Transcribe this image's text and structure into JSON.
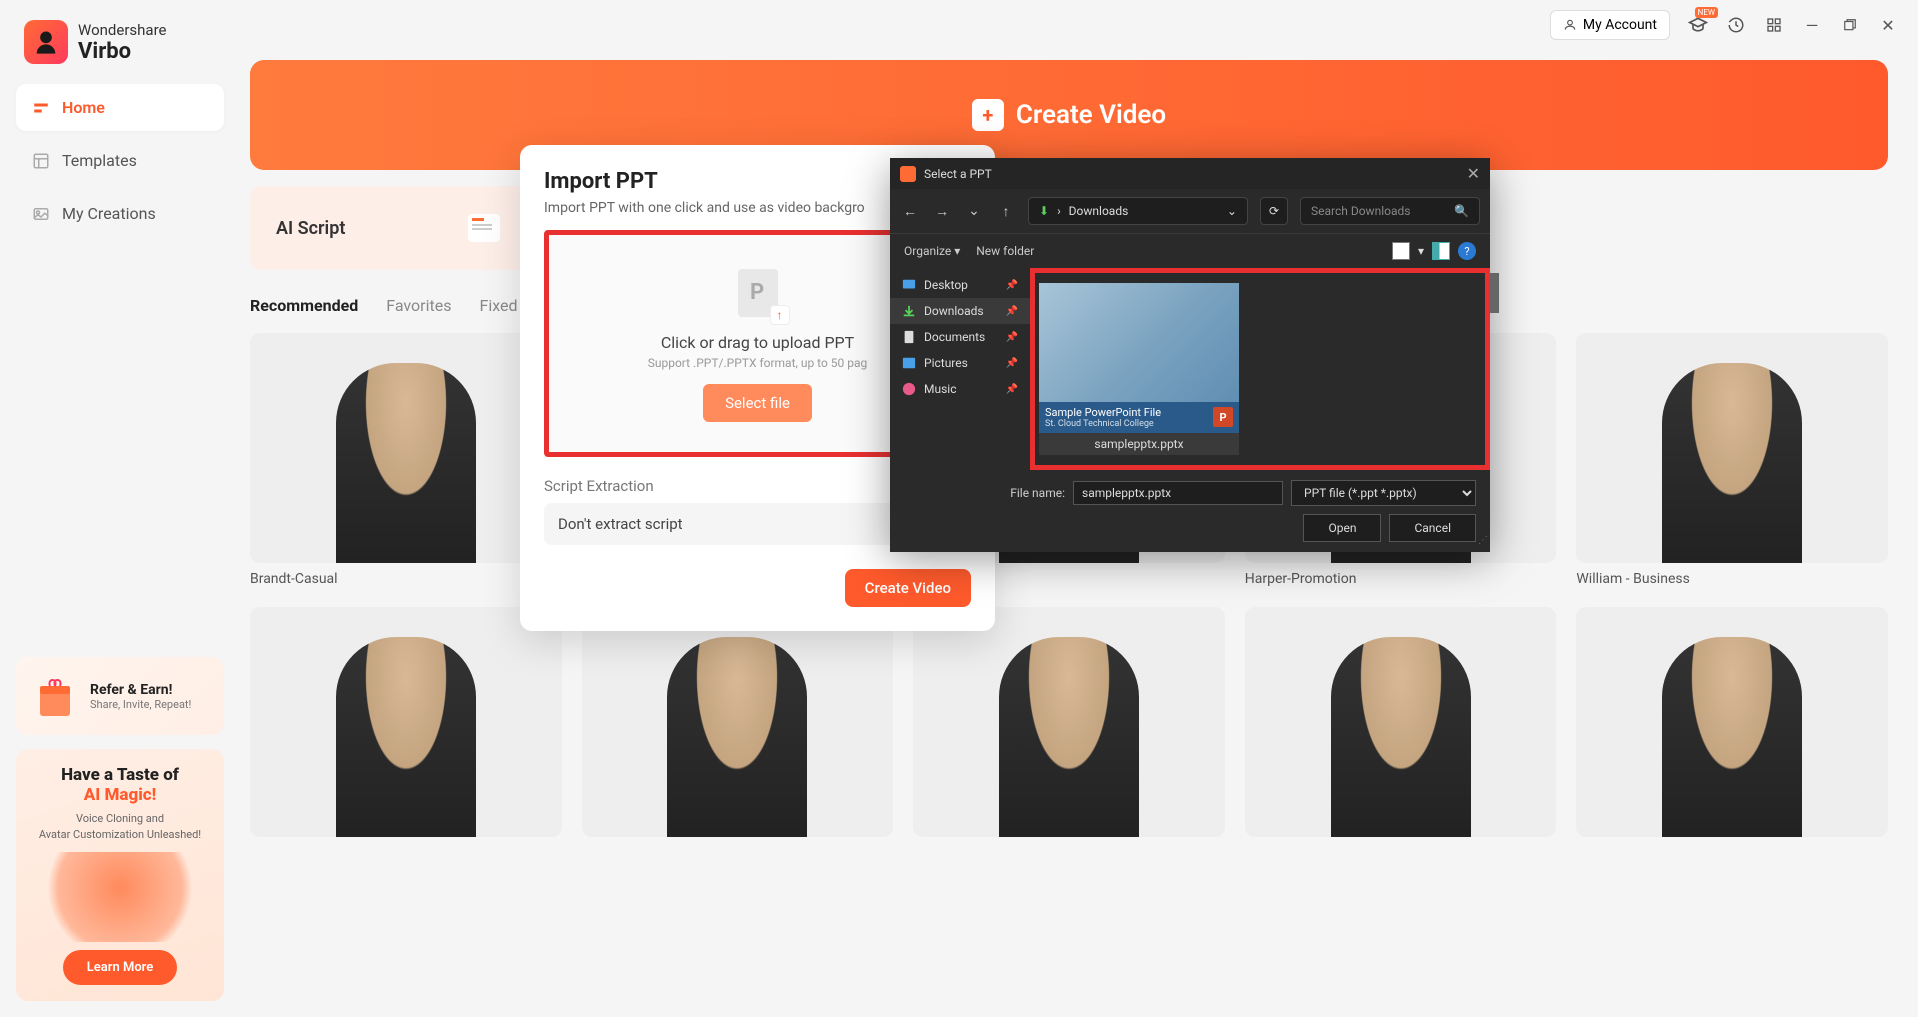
{
  "titlebar": {
    "account": "My Account",
    "new_badge": "NEW"
  },
  "logo": {
    "brand": "Wondershare",
    "name": "Virbo"
  },
  "nav": {
    "home": "Home",
    "templates": "Templates",
    "creations": "My Creations"
  },
  "promo1": {
    "title": "Refer & Earn!",
    "sub": "Share, Invite, Repeat!"
  },
  "promo2": {
    "h1": "Have a Taste of",
    "h2": "AI Magic!",
    "s1": "Voice Cloning and",
    "s2": "Avatar Customization Unleashed!",
    "btn": "Learn More"
  },
  "hero": {
    "label": "Create Video"
  },
  "ai_script": "AI Script",
  "tabs": {
    "recommended": "Recommended",
    "favorites": "Favorites",
    "fixed": "Fixed"
  },
  "avatars": {
    "a1": "Brandt-Casual",
    "a3": "Harper-Promotion",
    "a4": "William - Business"
  },
  "modal": {
    "title": "Import PPT",
    "sub": "Import PPT with one click and use as video backgro",
    "drop_text": "Click or drag to upload PPT",
    "drop_sub": "Support .PPT/.PPTX format, up to 50 pag",
    "select_file": "Select file",
    "script_ext": "Script Extraction",
    "extract_value": "Don't extract script",
    "create": "Create Video"
  },
  "fp": {
    "title": "Select a PPT",
    "path_label": "Downloads",
    "search_placeholder": "Search Downloads",
    "organize": "Organize",
    "new_folder": "New folder",
    "side": {
      "desktop": "Desktop",
      "downloads": "Downloads",
      "documents": "Documents",
      "pictures": "Pictures",
      "music": "Music"
    },
    "thumb_title": "Sample PowerPoint File",
    "thumb_sub": "St. Cloud Technical College",
    "thumb_name": "samplepptx.pptx",
    "filename_label": "File name:",
    "filename_value": "samplepptx.pptx",
    "filetype": "PPT file (*.ppt *.pptx)",
    "open": "Open",
    "cancel": "Cancel"
  }
}
